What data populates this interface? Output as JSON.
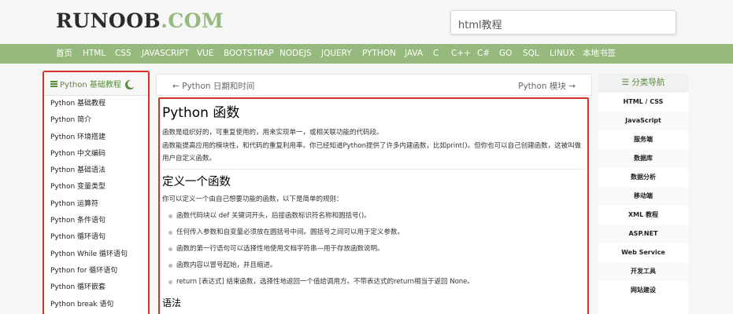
{
  "header": {
    "logo_main": "RUNOOB",
    "logo_suffix": ".COM",
    "search_placeholder": "html教程"
  },
  "nav": {
    "items": [
      "首页",
      "HTML",
      "CSS",
      "JAVASCRIPT",
      "VUE",
      "BOOTSTRAP",
      "NODEJS",
      "JQUERY",
      "PYTHON",
      "JAVA",
      "C",
      "C++",
      "C#",
      "GO",
      "SQL",
      "LINUX",
      "本地书签"
    ]
  },
  "left_sidebar": {
    "title": "Python 基础教程",
    "items": [
      "Python 基础教程",
      "Python 简介",
      "Python 环境搭建",
      "Python 中文编码",
      "Python 基础语法",
      "Python 变量类型",
      "Python 运算符",
      "Python 条件语句",
      "Python 循环语句",
      "Python While 循环语句",
      "Python for 循环语句",
      "Python 循环嵌套",
      "Python break 语句"
    ]
  },
  "pager": {
    "prev": "Python 日期和时间",
    "next": "Python 模块"
  },
  "article": {
    "title": "Python 函数",
    "intro1": "函数是组织好的，可重复使用的，用来实现单一，或相关联功能的代码段。",
    "intro2": "函数能提高应用的模块性，和代码的重复利用率。你已经知道Python提供了许多内建函数，比如print()。但你也可以自己创建函数，这被叫做用户自定义函数。",
    "section1_title": "定义一个函数",
    "section1_intro": "你可以定义一个由自己想要功能的函数，以下是简单的规则：",
    "rules": [
      "函数代码块以 def 关键词开头，后接函数标识符名称和圆括号()。",
      "任何传入参数和自变量必须放在圆括号中间。圆括号之间可以用于定义参数。",
      "函数的第一行语句可以选择性地使用文档字符串—用于存放函数说明。",
      "函数内容以冒号起始，并且缩进。",
      "return [表达式] 结束函数，选择性地返回一个值给调用方。不带表达式的return相当于返回 None。"
    ],
    "section2_title": "语法"
  },
  "right_sidebar": {
    "title": "分类导航",
    "items": [
      "HTML / CSS",
      "JavaScript",
      "服务端",
      "数据库",
      "数据分析",
      "移动端",
      "XML 教程",
      "ASP.NET",
      "Web Service",
      "开发工具",
      "网站建设"
    ]
  },
  "colors": {
    "brand_green": "#96b97d",
    "highlight_red": "#d9322a"
  }
}
